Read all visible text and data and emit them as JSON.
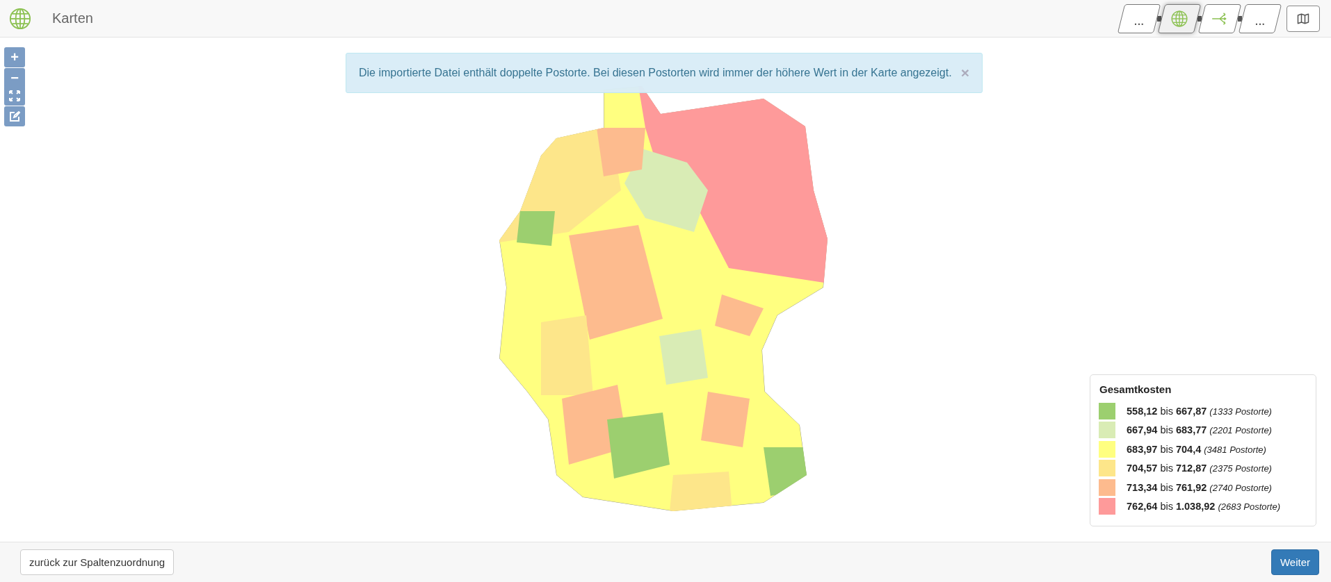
{
  "header": {
    "title": "Karten"
  },
  "steps": [
    {
      "kind": "ellipsis",
      "label": "...",
      "selected": false
    },
    {
      "kind": "globe",
      "selected": true
    },
    {
      "kind": "branch",
      "selected": false
    },
    {
      "kind": "ellipsis",
      "label": "...",
      "selected": false
    }
  ],
  "map_controls": {
    "zoom_in": "+",
    "zoom_out": "−"
  },
  "alert": {
    "message": "Die importierte Datei enthält doppelte Postorte. Bei diesen Postorten wird immer der höhere Wert in der Karte angezeigt.",
    "close": "×"
  },
  "legend": {
    "title": "Gesamtkosten",
    "items": [
      {
        "color": "#9ccf6f",
        "text": "**558,12** bis **667,87** *(1333 Postorte)*"
      },
      {
        "color": "#d9ecb5",
        "text": "**667,94** bis **683,77** *(2201 Postorte)*"
      },
      {
        "color": "#ffff80",
        "text": "**683,97** bis **704,4** *(3481 Postorte)*"
      },
      {
        "color": "#fde68a",
        "text": "**704,57** bis **712,87** *(2375 Postorte)*"
      },
      {
        "color": "#fdbb8e",
        "text": "**713,34** bis **761,92** *(2740 Postorte)*"
      },
      {
        "color": "#fe9a9a",
        "text": "**762,64** bis **1.038,92** *(2683 Postorte)*"
      }
    ]
  },
  "footer": {
    "back_button": "zurück zur Spaltenzuordnung",
    "next_button": "Weiter"
  }
}
